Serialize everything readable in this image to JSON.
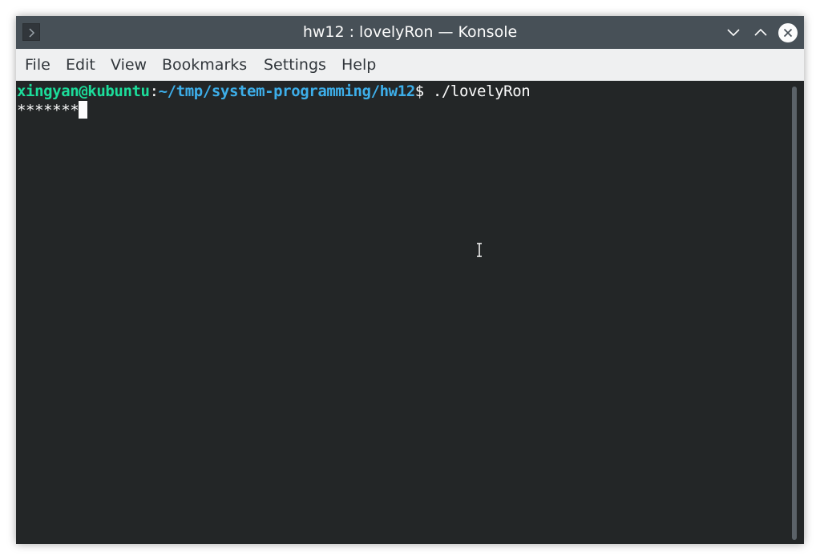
{
  "window": {
    "title": "hw12 : lovelyRon — Konsole",
    "app_icon": "konsole-prompt-icon",
    "controls": [
      "minimize-icon",
      "maximize-icon",
      "close-icon"
    ]
  },
  "menubar": {
    "items": [
      {
        "label": "File"
      },
      {
        "label": "Edit"
      },
      {
        "label": "View"
      },
      {
        "label": "Bookmarks"
      },
      {
        "label": "Settings"
      },
      {
        "label": "Help"
      }
    ]
  },
  "terminal": {
    "prompt_user": "xingyan@kubuntu",
    "prompt_sep": ":",
    "prompt_path": "~/tmp/system-programming/hw12",
    "prompt_command": "$ ./lovelyRon",
    "output_line": "*******"
  },
  "colors": {
    "titlebar": "#475057",
    "menubar": "#eff0f1",
    "terminal_bg": "#232627",
    "prompt_user": "#1cdc9a",
    "prompt_path": "#3daee9",
    "text": "#fcfcfc"
  }
}
